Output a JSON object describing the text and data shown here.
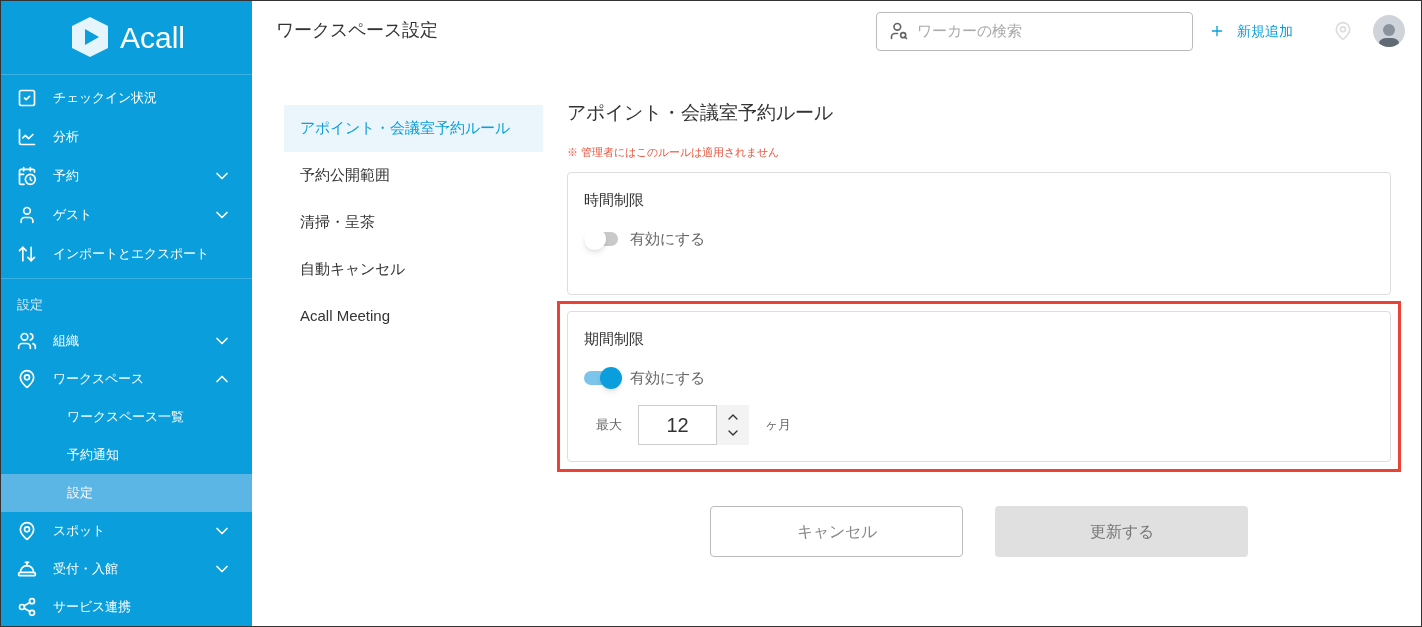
{
  "sidebar": {
    "logo": "Acall",
    "items": [
      {
        "label": "チェックイン状況"
      },
      {
        "label": "分析"
      },
      {
        "label": "予約",
        "expanded": false
      },
      {
        "label": "ゲスト",
        "expanded": false
      },
      {
        "label": "インポートとエクスポート"
      }
    ],
    "section_label": "設定",
    "settings_items": [
      {
        "label": "組織",
        "expanded": false
      },
      {
        "label": "ワークスペース",
        "expanded": true,
        "children": [
          {
            "label": "ワークスペース一覧",
            "selected": false
          },
          {
            "label": "予約通知",
            "selected": false
          },
          {
            "label": "設定",
            "selected": true
          }
        ]
      },
      {
        "label": "スポット",
        "expanded": false
      },
      {
        "label": "受付・入館",
        "expanded": false
      },
      {
        "label": "サービス連携"
      }
    ]
  },
  "header": {
    "title": "ワークスペース設定",
    "search": {
      "placeholder": "ワーカーの検索"
    },
    "add_link": "新規追加"
  },
  "settings_nav": [
    {
      "label": "アポイント・会議室予約ルール",
      "selected": true
    },
    {
      "label": "予約公開範囲",
      "selected": false
    },
    {
      "label": "清掃・呈茶",
      "selected": false
    },
    {
      "label": "自動キャンセル",
      "selected": false
    },
    {
      "label": "Acall Meeting",
      "selected": false
    }
  ],
  "content": {
    "title": "アポイント・会議室予約ルール",
    "note_mark": "※",
    "note": "管理者にはこのルールは適用されません",
    "cards": [
      {
        "title": "時間制限",
        "toggle_label": "有効にする",
        "on": false,
        "highlighted": false
      },
      {
        "title": "期間制限",
        "toggle_label": "有効にする",
        "on": true,
        "highlighted": true,
        "max_label": "最大",
        "max_value": "12",
        "unit": "ヶ月"
      }
    ],
    "buttons": [
      {
        "label": "キャンセル",
        "kind": "secondary",
        "disabled": false
      },
      {
        "label": "更新する",
        "kind": "primary",
        "disabled": true
      }
    ]
  }
}
